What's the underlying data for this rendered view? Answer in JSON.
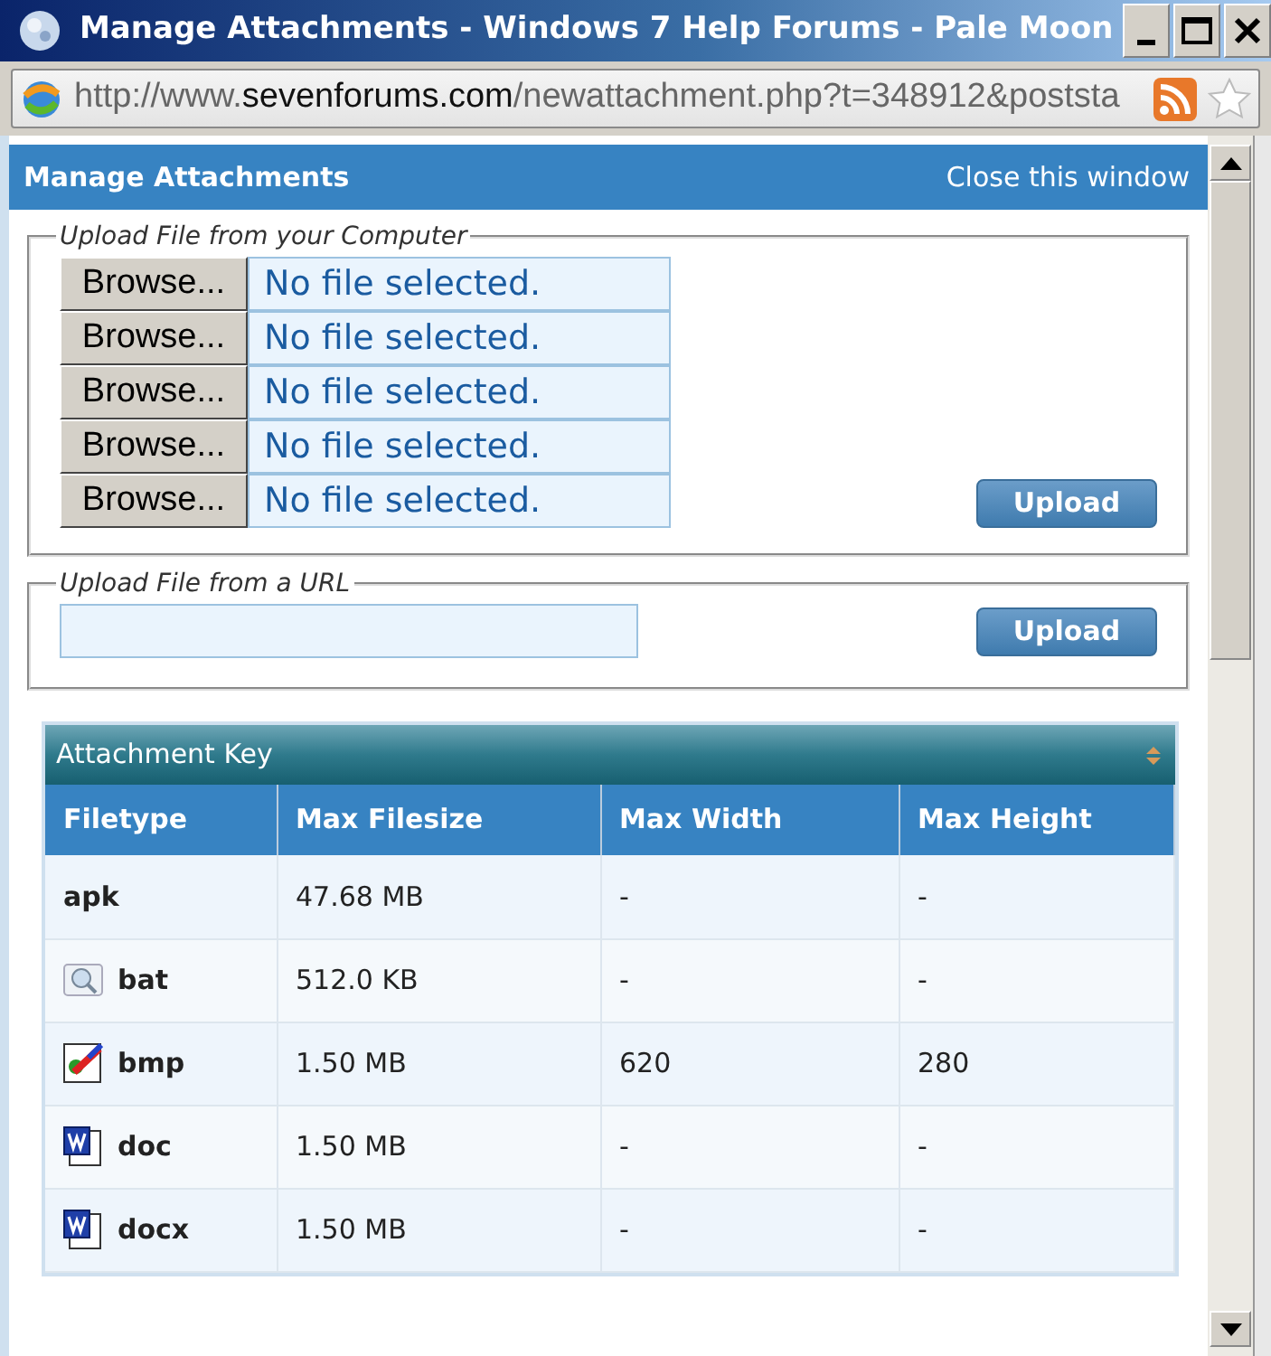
{
  "window": {
    "title": "Manage Attachments - Windows 7 Help Forums - Pale Moon"
  },
  "address_bar": {
    "url_start": "http://www.",
    "url_domain": "sevenforums.com",
    "url_end": "/newattachment.php?t=348912&poststa"
  },
  "popup": {
    "title": "Manage Attachments",
    "close_link": "Close this window"
  },
  "upload_computer": {
    "legend": "Upload File from your Computer",
    "files": [
      {
        "button": "Browse...",
        "status": "No file selected."
      },
      {
        "button": "Browse...",
        "status": "No file selected."
      },
      {
        "button": "Browse...",
        "status": "No file selected."
      },
      {
        "button": "Browse...",
        "status": "No file selected."
      },
      {
        "button": "Browse...",
        "status": "No file selected."
      }
    ],
    "upload_button": "Upload"
  },
  "upload_url": {
    "legend": "Upload File from a URL",
    "upload_button": "Upload"
  },
  "attachment_key": {
    "title": "Attachment Key",
    "columns": [
      "Filetype",
      "Max Filesize",
      "Max Width",
      "Max Height"
    ],
    "rows": [
      {
        "kind": "plain",
        "cells": [
          "apk",
          "47.68 MB",
          "-",
          "-"
        ]
      },
      {
        "kind": "script",
        "cells": [
          "bat",
          "512.0 KB",
          "-",
          "-"
        ]
      },
      {
        "kind": "image",
        "cells": [
          "bmp",
          "1.50 MB",
          "620",
          "280"
        ]
      },
      {
        "kind": "document",
        "cells": [
          "doc",
          "1.50 MB",
          "-",
          "-"
        ]
      },
      {
        "kind": "document",
        "cells": [
          "docx",
          "1.50 MB",
          "-",
          "-"
        ]
      }
    ]
  }
}
